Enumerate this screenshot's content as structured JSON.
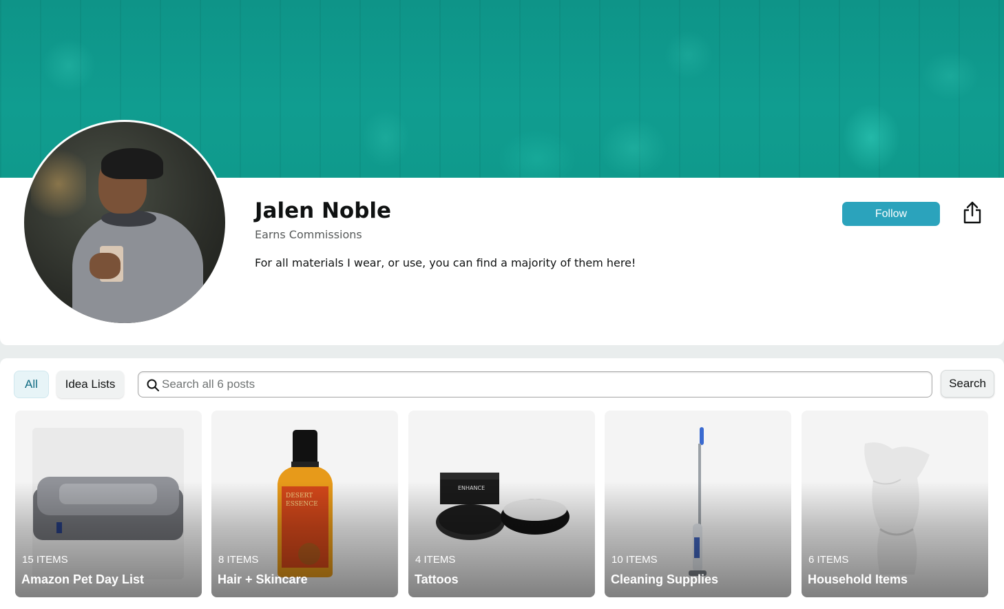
{
  "profile": {
    "name": "Jalen Noble",
    "subtitle": "Earns Commissions",
    "bio": "For all materials I wear, or use, you can find a majority of them here!",
    "follow_label": "Follow",
    "share_icon": "share-icon"
  },
  "filters": {
    "all_label": "All",
    "idea_lists_label": "Idea Lists",
    "active": "All"
  },
  "search": {
    "placeholder": "Search all 6 posts",
    "value": "",
    "button_label": "Search"
  },
  "colors": {
    "banner": "#0f9a8c",
    "follow_button": "#2ba3bc",
    "active_chip_bg": "#e7f4f7"
  },
  "cards": [
    {
      "count": "15 ITEMS",
      "title": "Amazon Pet Day List"
    },
    {
      "count": "8 ITEMS",
      "title": "Hair + Skincare"
    },
    {
      "count": "4 ITEMS",
      "title": "Tattoos"
    },
    {
      "count": "10 ITEMS",
      "title": "Cleaning Supplies"
    },
    {
      "count": "6 ITEMS",
      "title": "Household Items"
    }
  ]
}
